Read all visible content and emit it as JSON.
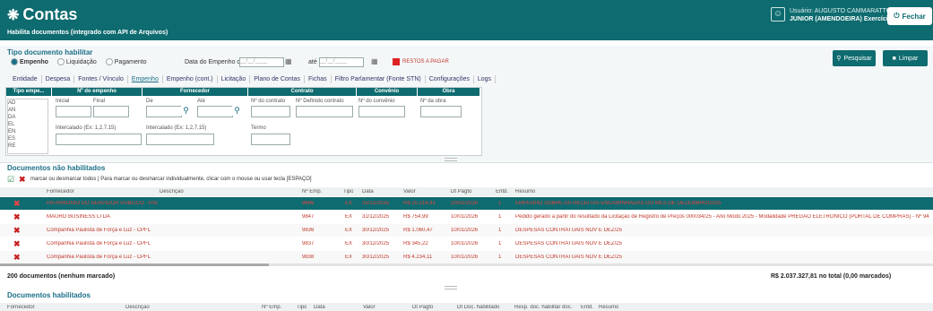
{
  "header": {
    "title": "Contas",
    "subtitle": "Habilita documentos (integrado com API de Arquivos)",
    "user_line1": "Usuário: AUGUSTO CAMMARATTO",
    "user_line2": "JUNIOR (AMENDOEIRA) Exercício: 2026",
    "close_label": "Fechar"
  },
  "filter": {
    "section_title": "Tipo documento habilitar",
    "radios": [
      "Empenho",
      "Liquidação",
      "Pagamento"
    ],
    "date_label": "Data do Empenho de:",
    "date_from": "__/__/____",
    "until_label": "até",
    "date_to": "__/__/____",
    "restos_label": "RESTOS A PAGAR",
    "tabs": [
      "Entidade",
      "Despesa",
      "Fontes / Vínculo",
      "Empenho",
      "Empenho (cont.)",
      "Licitação",
      "Plano de Contas",
      "Fichas",
      "Filtro Parlamentar (Fonte STN)",
      "Configurações",
      "Logs"
    ],
    "search_label": "Pesquisar",
    "clear_label": "Limpar",
    "tipo_header": "Tipo empe...",
    "tipo_items": [
      "AD",
      "AN",
      "DA",
      "EL",
      "EN",
      "ES",
      "RE"
    ],
    "numero_header": "Nº do empenho",
    "inicial_label": "Inicial",
    "final_label": "Final",
    "intercalado_label": "Intercalado (Ex: 1,2,7,15)",
    "fornecedor_header": "Fornecedor",
    "de_label": "De",
    "ate_label": "Até",
    "intercalado2_label": "Intercalado (Ex: 1,2,7,15)",
    "termo_label": "Termo",
    "contrato_header": "Contrato",
    "contrato_label": "Nº do contrato",
    "contrato_def_label": "Nº Definido contrato",
    "convenio_header": "Convênio",
    "convenio_label": "Nº do convênio",
    "obra_header": "Obra",
    "obra_label": "Nº da obra"
  },
  "nao_habilitados": {
    "title": "Documentos não habilitados",
    "hint": "marcar ou desmarcar todos | Para marcar ou desmarcar individualmente, clicar com o mouse ou usar tecla [ESPAÇO]",
    "columns": [
      "Fornecedor",
      "Descrição",
      "Nº Emp.",
      "Tipo",
      "Data",
      "Valor",
      "Dt Pagto",
      "Entd.",
      "Resumo"
    ],
    "rows": [
      {
        "fornecedor": "PATRIMONIO DO SERVIDOR PUBLICO - PSI",
        "emp": "9686",
        "tipo": "EX",
        "data": "31/12/2025",
        "valor": "R$ 25.216,41",
        "pagto": "20/01/2026",
        "entd": "1",
        "resumo": "EMPENHO SOBRE AS RECEITAS ENCAMINHADAS DO MES DE DEZEMBRO/2025",
        "sel": true
      },
      {
        "fornecedor": "MAURO BUSINESS LTDA",
        "emp": "9847",
        "tipo": "EX",
        "data": "31/12/2025",
        "valor": "R$ 754,99",
        "pagto": "10/01/2026",
        "entd": "1",
        "resumo": "Pedido gerado a partir do resultado da Licitação de Registro de Preços 000034/25 - Ano Modo 2025 - Modalidade PREGÃO ELETRÔNICO (PORTAL DE COMPRAS) - Nº 94",
        "sel": false
      },
      {
        "fornecedor": "Companhia Paulista de Força e Luz - CPFL",
        "emp": "9836",
        "tipo": "EX",
        "data": "30/12/2025",
        "valor": "R$ 1.060,47",
        "pagto": "10/01/2026",
        "entd": "1",
        "resumo": "DESPESAS CONTRATUAIS NOV E DEZ/25",
        "sel": false
      },
      {
        "fornecedor": "Companhia Paulista de Força e Luz - CPFL",
        "emp": "9837",
        "tipo": "EX",
        "data": "30/12/2025",
        "valor": "R$ 345,22",
        "pagto": "10/01/2026",
        "entd": "1",
        "resumo": "DESPESAS CONTRATUAIS NOV E DEZ/25",
        "sel": false
      },
      {
        "fornecedor": "Companhia Paulista de Força e Luz - CPFL",
        "emp": "9838",
        "tipo": "EX",
        "data": "30/12/2025",
        "valor": "R$ 4.234,11",
        "pagto": "10/01/2026",
        "entd": "1",
        "resumo": "DESPESAS CONTRATUAIS NOV E DEZ/25",
        "sel": false
      }
    ],
    "count_text": "200 documentos (nenhum marcado)",
    "total_text": "R$ 2.037.327,81 no total (0,00 marcados)"
  },
  "habilitados": {
    "title": "Documentos habilitados",
    "columns": [
      "Fornecedor",
      "Descrição",
      "Nº Emp.",
      "Tipo",
      "Data",
      "Valor",
      "Dt Pagto",
      "Dt Doc. habilitado",
      "Resp. doc. habilitar doc.",
      "Entd.",
      "Resumo"
    ]
  }
}
